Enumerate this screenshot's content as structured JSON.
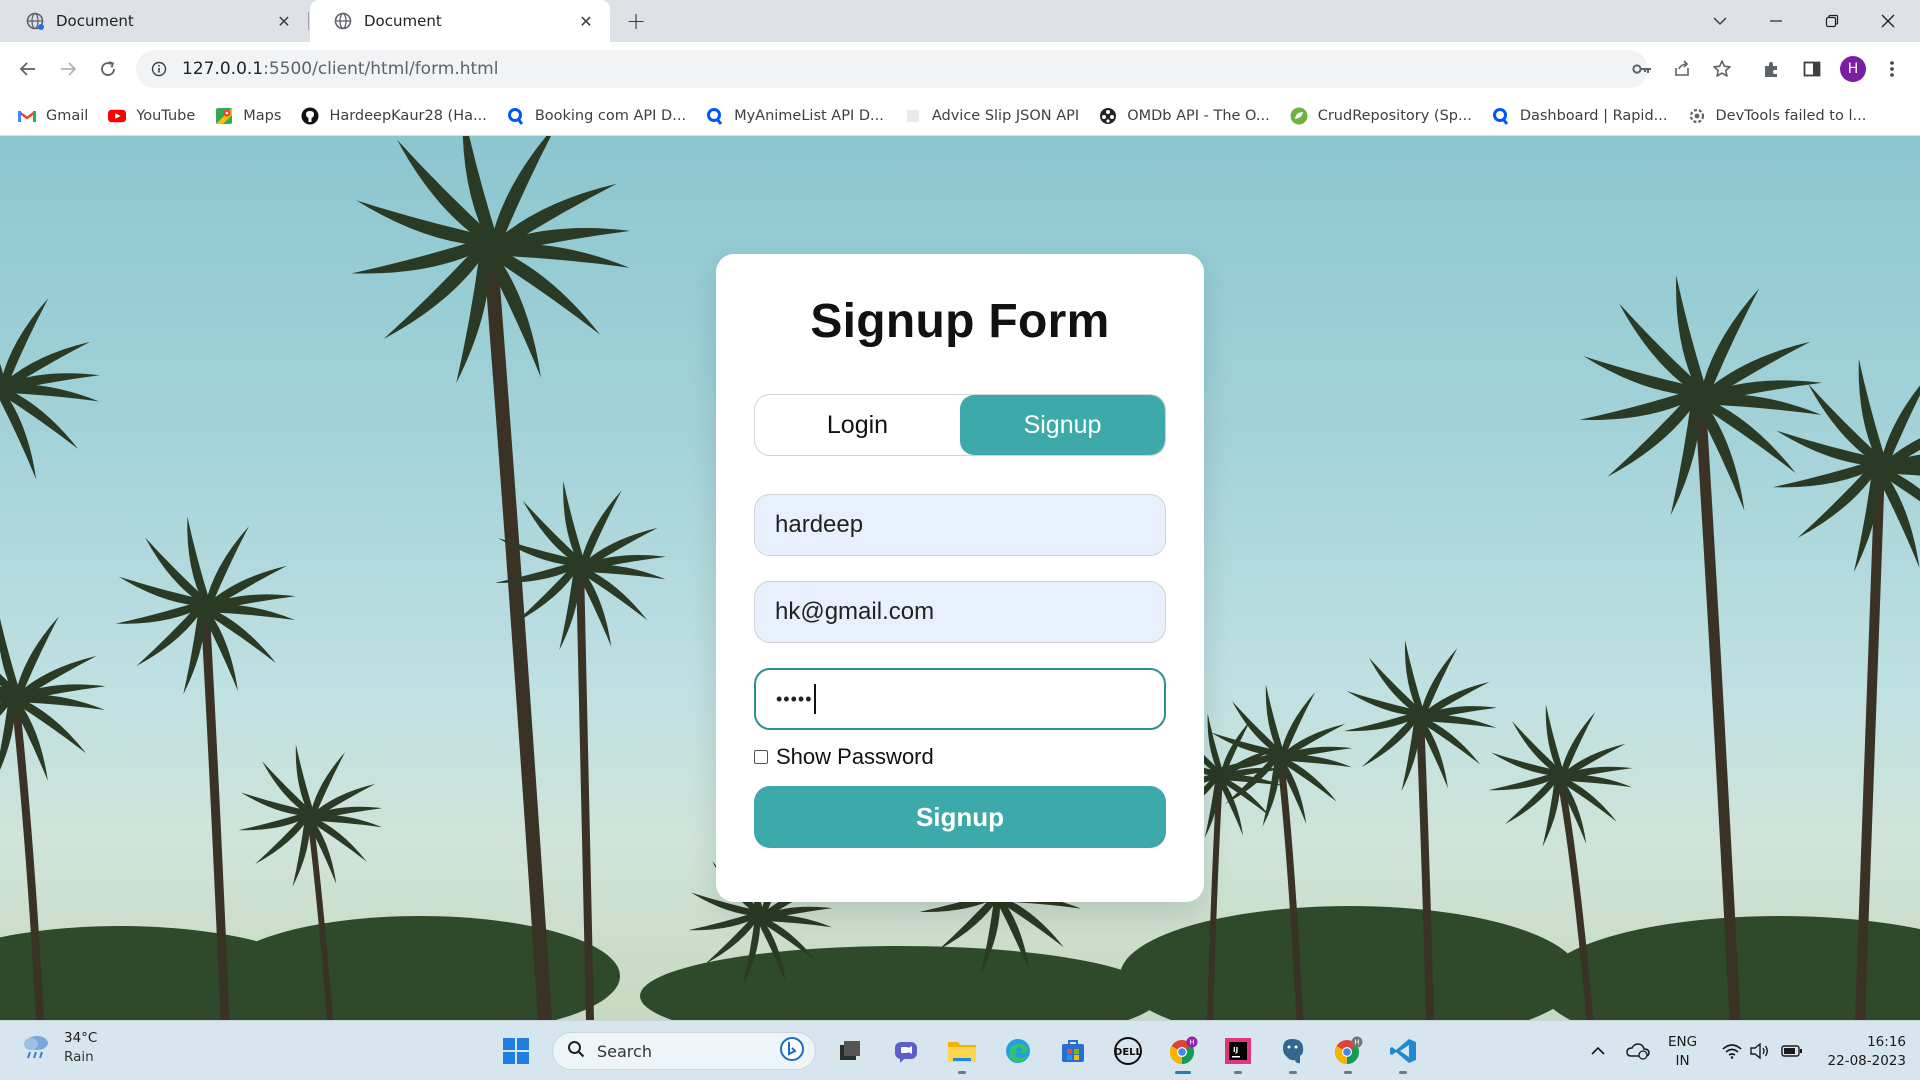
{
  "browser": {
    "tabs": [
      {
        "title": "Document",
        "active": false
      },
      {
        "title": "Document",
        "active": true
      }
    ],
    "url_host": "127.0.0.1",
    "url_rest": ":5500/client/html/form.html",
    "profile_initial": "H",
    "bookmarks": [
      {
        "label": "Gmail",
        "icon": "gmail-icon"
      },
      {
        "label": "YouTube",
        "icon": "youtube-icon"
      },
      {
        "label": "Maps",
        "icon": "maps-icon"
      },
      {
        "label": "HardeepKaur28 (Ha...",
        "icon": "github-icon"
      },
      {
        "label": "Booking com API D...",
        "icon": "rapidapi-icon"
      },
      {
        "label": "MyAnimeList API D...",
        "icon": "rapidapi-icon"
      },
      {
        "label": "Advice Slip JSON API",
        "icon": "page-icon"
      },
      {
        "label": "OMDb API - The O...",
        "icon": "omdb-icon"
      },
      {
        "label": "CrudRepository (Sp...",
        "icon": "spring-icon"
      },
      {
        "label": "Dashboard | Rapid...",
        "icon": "rapidapi-icon"
      },
      {
        "label": "DevTools failed to l...",
        "icon": "devtools-icon"
      }
    ]
  },
  "form": {
    "title": "Signup Form",
    "tab_login": "Login",
    "tab_signup": "Signup",
    "active_tab": "Signup",
    "name_value": "hardeep",
    "email_value": "hk@gmail.com",
    "password_masked": "•••••",
    "show_password_label": "Show Password",
    "show_password_checked": false,
    "submit_label": "Signup",
    "accent_color": "#3ea9ab"
  },
  "taskbar": {
    "weather_temp": "34°C",
    "weather_desc": "Rain",
    "search_label": "Search",
    "lang_top": "ENG",
    "lang_bottom": "IN",
    "time": "16:16",
    "date": "22-08-2023"
  }
}
